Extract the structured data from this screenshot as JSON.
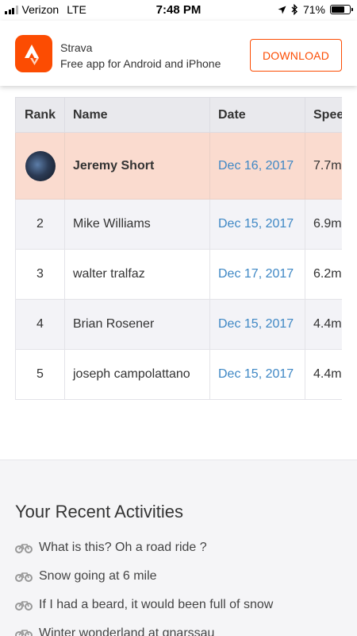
{
  "status_bar": {
    "carrier": "Verizon",
    "network": "LTE",
    "time": "7:48 PM",
    "battery": "71%",
    "battery_level": 0.71
  },
  "banner": {
    "app_name": "Strava",
    "subtitle": "Free app for Android and iPhone",
    "download_label": "DOWNLOAD",
    "brand_color": "#fc4c02"
  },
  "leaderboard": {
    "columns": [
      "Rank",
      "Name",
      "Date",
      "Spee"
    ],
    "rows": [
      {
        "rank": "",
        "name": "Jeremy Short",
        "date": "Dec 16, 2017",
        "speed": "7.7m"
      },
      {
        "rank": "2",
        "name": "Mike Williams",
        "date": "Dec 15, 2017",
        "speed": "6.9m"
      },
      {
        "rank": "3",
        "name": "walter tralfaz",
        "date": "Dec 17, 2017",
        "speed": "6.2m"
      },
      {
        "rank": "4",
        "name": "Brian Rosener",
        "date": "Dec 15, 2017",
        "speed": "4.4m"
      },
      {
        "rank": "5",
        "name": "joseph campolattano",
        "date": "Dec 15, 2017",
        "speed": "4.4m"
      }
    ],
    "highlight_color": "#fadbcf",
    "link_color": "#3f88c5"
  },
  "recent": {
    "title": "Your Recent Activities",
    "activities": [
      "What is this? Oh a road ride ?",
      "Snow going at 6 mile",
      "If I had a beard, it would been full of snow",
      "Winter wonderland at gnarssau"
    ]
  }
}
